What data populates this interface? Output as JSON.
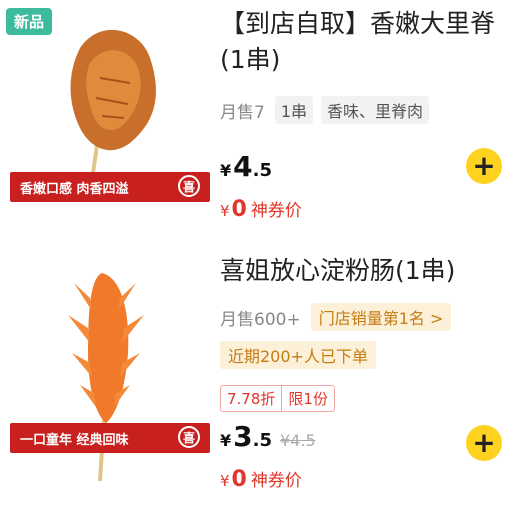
{
  "items": [
    {
      "badge": "新品",
      "banner": "香嫩口感 肉香四溢",
      "seal": "喜",
      "title": "【到店自取】香嫩大里脊(1串)",
      "sales": "月售7",
      "tags": [
        "1串",
        "香味、里脊肉"
      ],
      "price_yen": "¥",
      "price_int": "4",
      "price_dec": ".5",
      "coupon_yen": "¥",
      "coupon_value": "0",
      "coupon_text": "神券价",
      "add": "+"
    },
    {
      "banner": "一口童年 经典回味",
      "seal": "喜",
      "title": "喜姐放心淀粉肠(1串)",
      "sales": "月售600+",
      "rank_tag": "门店销量第1名 >",
      "hot_tag": "近期200+人已下单",
      "discount": "7.78折",
      "limit": "限1份",
      "price_yen": "¥",
      "price_int": "3",
      "price_dec": ".5",
      "orig_price": "¥4.5",
      "coupon_yen": "¥",
      "coupon_value": "0",
      "coupon_text": "神券价",
      "add": "+"
    }
  ]
}
